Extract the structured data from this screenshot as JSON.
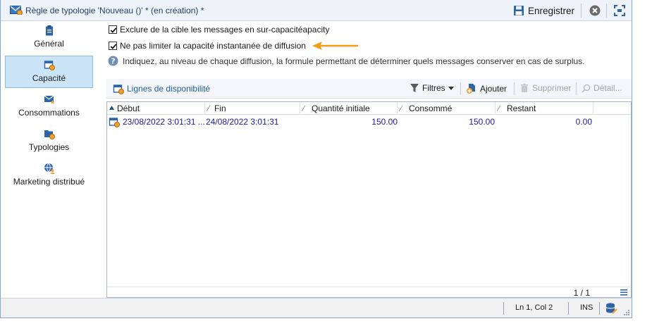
{
  "window": {
    "title": "Règle de typologie 'Nouveau ()' * (en création) *",
    "save_label": "Enregistrer",
    "icons": {
      "title": "typology-rule-icon",
      "save": "floppy-disk-icon",
      "close": "close-circle-icon",
      "fullscreen": "fullscreen-icon"
    }
  },
  "sidebar": {
    "items": [
      {
        "label": "Général",
        "icon": "clipboard-icon",
        "active": false
      },
      {
        "label": "Capacité",
        "icon": "calendar-gear-icon",
        "active": true
      },
      {
        "label": "Consommations",
        "icon": "envelope-star-icon",
        "active": false
      },
      {
        "label": "Typologies",
        "icon": "folder-gear-icon",
        "active": false
      },
      {
        "label": "Marketing distribué",
        "icon": "globe-user-icon",
        "active": false
      }
    ]
  },
  "main": {
    "checkbox_exclude": {
      "label": "Exclure de la cible les messages en sur-capacitéapacity",
      "checked": true
    },
    "checkbox_no_limit": {
      "label": "Ne pas limiter la capacité instantanée de diffusion",
      "checked": true
    },
    "help_text": "Indiquez, au niveau de chaque diffusion, la formule permettant de déterminer quels messages conserver en cas de surplus.",
    "arrow_color": "#f39c12"
  },
  "list": {
    "title": "Lignes de disponibilité",
    "toolbar": {
      "filters": "Filtres",
      "add": "Ajouter",
      "delete": "Supprimer",
      "detail": "Détail..."
    },
    "columns": [
      "Début",
      "Fin",
      "Quantité initiale",
      "Consommé",
      "Restant"
    ],
    "rows": [
      {
        "debut": "23/08/2022 3:01:31 ...",
        "fin": "24/08/2022 3:01:31",
        "quantite": "150.00",
        "consomme": "150.00",
        "restant": "0.00"
      }
    ],
    "pager": "1 / 1"
  },
  "statusbar": {
    "position": "Ln 1, Col 2",
    "mode": "INS"
  },
  "colors": {
    "accent": "#1f5c99",
    "selection": "#cce4f7",
    "cell_text": "#1a1aa8"
  }
}
